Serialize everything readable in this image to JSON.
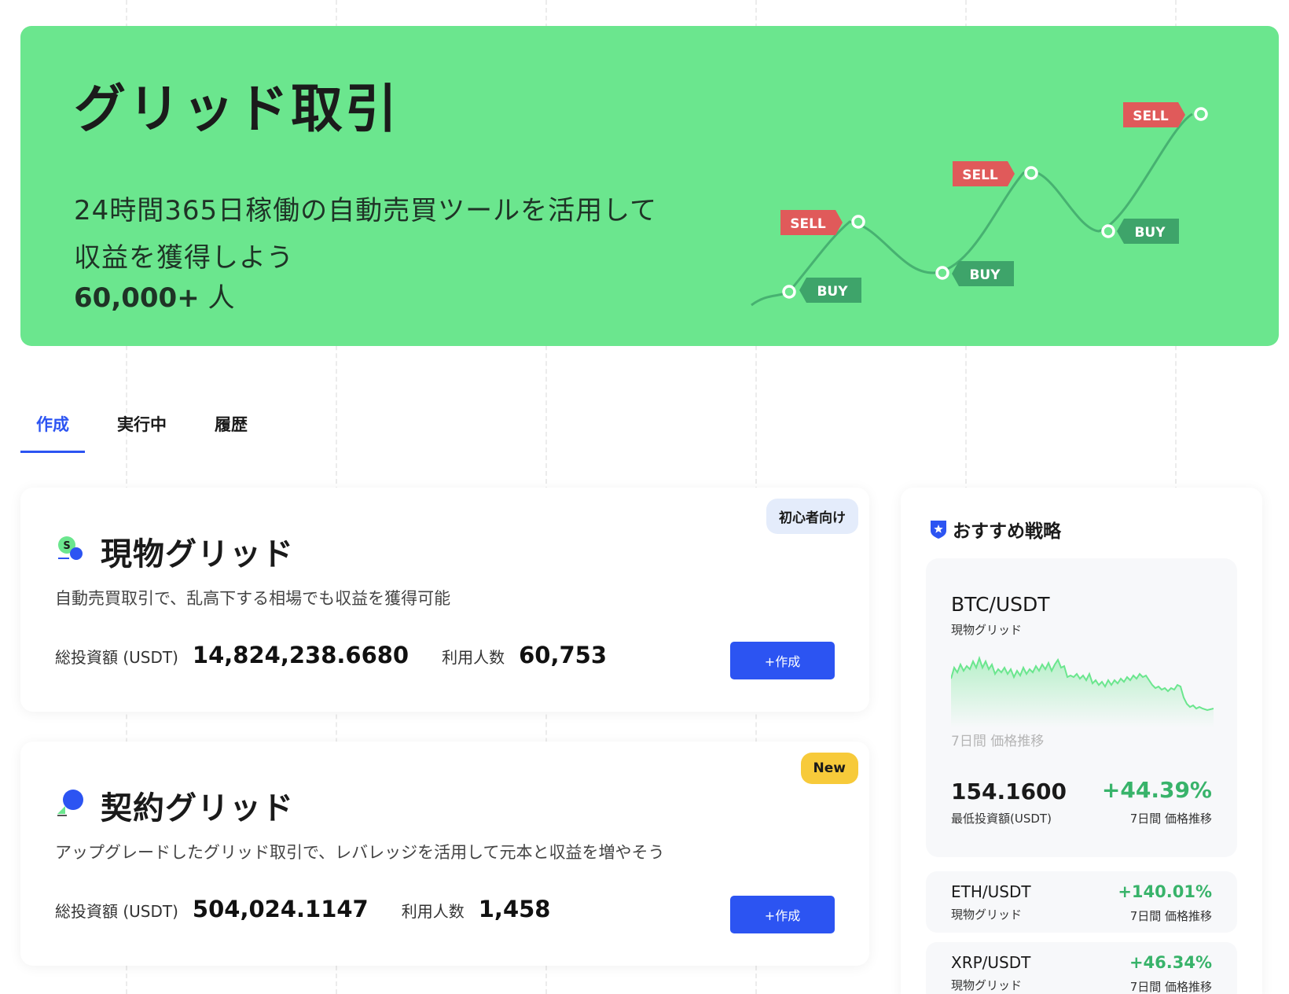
{
  "hero": {
    "title": "グリッド取引",
    "subtitle_line1": "24時間365日稼働の自動売買ツールを活用して",
    "subtitle_line2": "収益を獲得しよう",
    "user_count": "60,000+",
    "user_count_unit": " 人",
    "chart_tags": {
      "sell1": "SELL",
      "sell2": "SELL",
      "sell3": "SELL",
      "buy1": "BUY",
      "buy2": "BUY",
      "buy3": "BUY"
    }
  },
  "tabs": [
    "作成",
    "実行中",
    "履歴"
  ],
  "cards": [
    {
      "badge": "初心者向け",
      "title": "現物グリッド",
      "description": "自動売買取引で、乱高下する相場でも収益を獲得可能",
      "invest_label": "総投資額 (USDT)",
      "invest_value": "14,824,238.6680",
      "users_label": "利用人数",
      "users_value": "60,753",
      "button": "+作成"
    },
    {
      "badge": "New",
      "title": "契約グリッド",
      "description": "アップグレードしたグリッド取引で、レバレッジを活用して元本と収益を増やそう",
      "invest_label": "総投資額 (USDT)",
      "invest_value": "504,024.1147",
      "users_label": "利用人数",
      "users_value": "1,458",
      "button": "+作成"
    }
  ],
  "recommend": {
    "heading": "おすすめ戦略",
    "featured": {
      "pair": "BTC/USDT",
      "kind": "現物グリッド",
      "chart_caption": "7日間 価格推移",
      "min_invest": "154.1600",
      "min_invest_label": "最低投資額(USDT)",
      "change": "+44.39%",
      "change_label": "7日間 価格推移"
    },
    "items": [
      {
        "pair": "ETH/USDT",
        "kind": "現物グリッド",
        "change": "+140.01%",
        "change_label": "7日間 価格推移"
      },
      {
        "pair": "XRP/USDT",
        "kind": "現物グリッド",
        "change": "+46.34%",
        "change_label": "7日間 価格推移"
      }
    ]
  },
  "colors": {
    "hero_bg": "#6be68e",
    "accent_blue": "#2c54f2",
    "sell_red": "#e05a5a",
    "buy_green": "#3ea46a",
    "gain_green": "#38b36a",
    "badge_new": "#f7ca3a"
  }
}
